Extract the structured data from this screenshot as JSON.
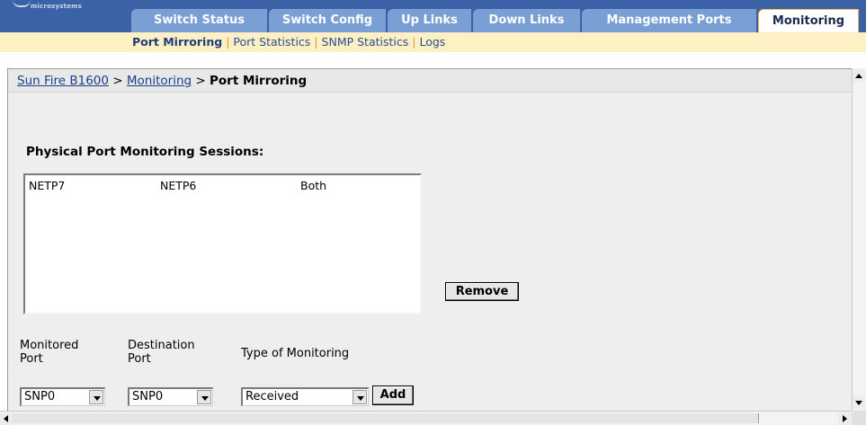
{
  "header": {
    "logo_text": "microsystems",
    "tabs": [
      {
        "label": "Switch Status"
      },
      {
        "label": "Switch Config"
      },
      {
        "label": "Up Links"
      },
      {
        "label": "Down Links"
      },
      {
        "label": "Management Ports"
      },
      {
        "label": "Monitoring",
        "active": true
      }
    ]
  },
  "subnav": {
    "items": [
      {
        "label": "Port Mirroring",
        "active": true
      },
      {
        "label": "Port Statistics"
      },
      {
        "label": "SNMP Statistics"
      },
      {
        "label": "Logs"
      }
    ],
    "separator": "|"
  },
  "breadcrumb": {
    "root": "Sun Fire B1600",
    "section": "Monitoring",
    "current": "Port Mirroring",
    "separator": ">"
  },
  "sessions": {
    "title": "Physical Port Monitoring Sessions:",
    "rows": [
      {
        "monitored": "NETP7",
        "destination": "NETP6",
        "type": "Both"
      }
    ],
    "remove_label": "Remove"
  },
  "form": {
    "monitored_label": "Monitored Port",
    "destination_label": "Destination Port",
    "type_label": "Type of Monitoring",
    "monitored_value": "SNP0",
    "destination_value": "SNP0",
    "type_value": "Received",
    "add_label": "Add"
  },
  "colors": {
    "header_bg": "#3b62a6",
    "tab_bg": "#7a9fd4",
    "subnav_bg": "#fdf0c4",
    "content_bg": "#eeeeee"
  }
}
